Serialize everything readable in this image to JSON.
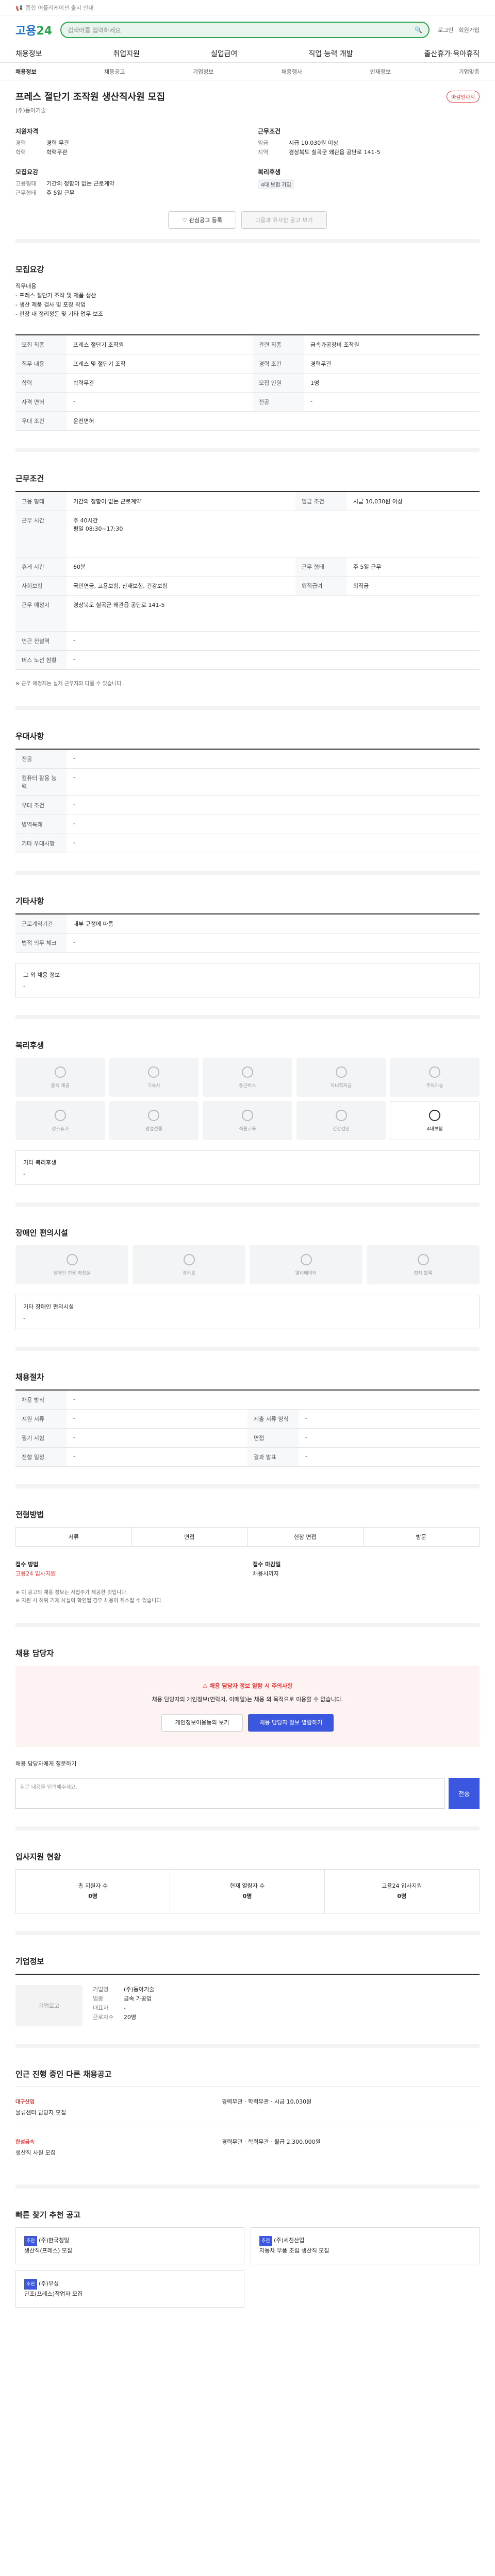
{
  "topbar": {
    "notice": "통합 어플리케이션 출시 안내"
  },
  "header": {
    "logo_a": "고용",
    "logo_b": "24",
    "search_placeholder": "검색어를 입력하세요",
    "util": [
      "로그인",
      "회원가입"
    ]
  },
  "gnb": [
    "채용정보",
    "취업지원",
    "실업급여",
    "직업 능력 개발",
    "출산휴가·육아휴직"
  ],
  "subnav": [
    "채용정보",
    "채용공고",
    "기업정보",
    "채용행사",
    "인재정보",
    "기업맞춤"
  ],
  "job": {
    "title": "프레스 절단기 조작원 생산직사원 모집",
    "dday": "마감일까지",
    "company": "(주)동아기술",
    "left_heading": "지원자격",
    "left": [
      [
        "경력",
        "경력 무관"
      ],
      [
        "학력",
        "학력무관"
      ]
    ],
    "left2_heading": "모집요강",
    "left2": [
      [
        "고용형태",
        "기간의 정함이 없는 근로계약"
      ],
      [
        "근무형태",
        "주 5일 근무"
      ]
    ],
    "right_heading": "근무조건",
    "right": [
      [
        "임금",
        "시급 10,030원 이상"
      ],
      [
        "지역",
        "경상북도 칠곡군 왜관읍 공단로 141-5"
      ]
    ],
    "right2_heading": "복리후생",
    "right2_tag": "4대 보험 가입",
    "btn_scrap": "관심공고 등록",
    "btn_similar": "다음과 유사한 공고 보기"
  },
  "recruit": {
    "heading": "모집요강",
    "desc": "직무내용\n- 프레스 절단기 조작 및 제품 생산\n- 생산 제품 검사 및 포장 작업\n- 현장 내 정리정돈 및 기타 업무 보조",
    "rows": [
      [
        "모집 직종",
        "프레스 절단기 조작원",
        "관련 직종",
        "금속가공장비 조작원"
      ],
      [
        "직무 내용",
        "프레스 및 절단기 조작",
        "경력 조건",
        "경력무관"
      ],
      [
        "학력",
        "학력무관",
        "모집 인원",
        "1명"
      ],
      [
        "자격 면허",
        "-",
        "전공",
        "-"
      ],
      [
        "우대 조건",
        "운전면허",
        "",
        ""
      ]
    ]
  },
  "conditions": {
    "heading": "근무조건",
    "rows": [
      [
        "고용 형태",
        "기간의 정함이 없는 근로계약",
        "임금 조건",
        "시급 10,030원 이상"
      ],
      [
        "근무 시간",
        "주 40시간\n평일 08:30~17:30",
        "",
        ""
      ],
      [
        "휴게 시간",
        "60분",
        "근무 형태",
        "주 5일 근무"
      ],
      [
        "사회보험",
        "국민연금, 고용보험, 산재보험, 건강보험",
        "퇴직급여",
        "퇴직금"
      ],
      [
        "근무 예정지",
        "경상북도 칠곡군 왜관읍 공단로 141-5",
        "",
        ""
      ],
      [
        "인근 전철역",
        "-",
        "",
        ""
      ],
      [
        "버스 노선 현황",
        "-",
        "",
        ""
      ]
    ],
    "footnote": "※ 근무 예정지는 실제 근무지와 다를 수 있습니다."
  },
  "preference": {
    "heading": "우대사항",
    "rows": [
      [
        "전공",
        "-"
      ],
      [
        "컴퓨터 활용 능력",
        "-"
      ],
      [
        "우대 조건",
        "-"
      ],
      [
        "병역특례",
        "-"
      ],
      [
        "기타 우대사항",
        "-"
      ]
    ]
  },
  "etc": {
    "heading": "기타사항",
    "rows": [
      [
        "근로계약기간",
        "내부 규정에 따름"
      ],
      [
        "법적 의무 체크",
        "-"
      ]
    ],
    "memo_label": "그 외 채용 정보",
    "memo": "-"
  },
  "welfare": {
    "heading": "복리후생",
    "items": [
      "중식 제공",
      "기숙사",
      "통근버스",
      "자녀학자금",
      "주차가능",
      "경조휴가",
      "명절선물",
      "직원교육",
      "건강검진",
      "4대보험"
    ],
    "selected": "4대보험",
    "extra_label": "기타 복리후생",
    "extra": "-"
  },
  "disability": {
    "heading": "장애인 편의시설",
    "items": [
      "장애인 전용 화장실",
      "경사로",
      "엘리베이터",
      "점자 블록"
    ],
    "extra_label": "기타 장애인 편의시설",
    "extra": "-"
  },
  "process": {
    "heading": "채용절차",
    "rows": [
      [
        "채용 방식",
        "-"
      ],
      [
        "지원 서류",
        "-",
        "제출 서류 양식",
        "-"
      ],
      [
        "필기 시험",
        "-",
        "면접",
        "-"
      ],
      [
        "전형 일정",
        "-",
        "결과 발표",
        "-"
      ]
    ]
  },
  "apply": {
    "heading": "전형방법",
    "methods": [
      "서류",
      "면접",
      "현장 면접",
      "방문"
    ],
    "col1_label": "접수 방법",
    "col1": "고용24 입사지원",
    "col2_label": "접수 마감일",
    "col2": "채용시까지",
    "notes": [
      "※ 이 공고의 채용 정보는 사업주가 제공한 것입니다.",
      "※ 지원 시 허위 기재 사실이 확인될 경우 채용이 취소될 수 있습니다."
    ]
  },
  "contact": {
    "heading": "채용 담당자",
    "alert_title": "채용 담당자 정보 열람 시 주의사항",
    "alert_body": "채용 담당자의 개인정보(연락처, 이메일)는 채용 외 목적으로 이용할 수 없습니다.",
    "btn_view": "개인정보이용동의 보기",
    "btn_confirm": "채용 담당자 정보 열람하기",
    "ask_label": "채용 담당자에게 질문하기",
    "ask_placeholder": "질문 내용을 입력해주세요.",
    "ask_btn": "전송"
  },
  "skills": {
    "heading": "입사지원 현황",
    "items": [
      [
        "총 지원자 수",
        "0명"
      ],
      [
        "현재 열람자 수",
        "0명"
      ],
      [
        "고용24 입사지원",
        "0명"
      ]
    ]
  },
  "company_info": {
    "heading": "기업정보",
    "logo": "기업로고",
    "rows": [
      [
        "기업명",
        "(주)동아기술"
      ],
      [
        "업종",
        "금속 가공업"
      ],
      [
        "대표자",
        "-"
      ],
      [
        "근로자수",
        "20명"
      ]
    ]
  },
  "related": {
    "heading": "인근 진행 중인 다른 채용공고",
    "jobs": [
      {
        "co": "대구산업",
        "title": "물류센터 담당자 모집",
        "cond": "경력무관 · 학력무관 · 시급 10,030원"
      },
      {
        "co": "한성금속",
        "title": "생산직 사원 모집",
        "cond": "경력무관 · 학력무관 · 월급 2,300,000원"
      }
    ]
  },
  "recommend": {
    "heading": "빠른 찾기 추천 공고",
    "cards": [
      {
        "lab": "추천",
        "co": "(주)한국정밀",
        "title": "생산직(프레스) 모집"
      },
      {
        "lab": "추천",
        "co": "(주)세진산업",
        "title": "자동차 부품 조립 생산직 모집"
      },
      {
        "lab": "추천",
        "co": "(주)우성",
        "title": "단조(프레스)작업자 모집"
      }
    ]
  }
}
